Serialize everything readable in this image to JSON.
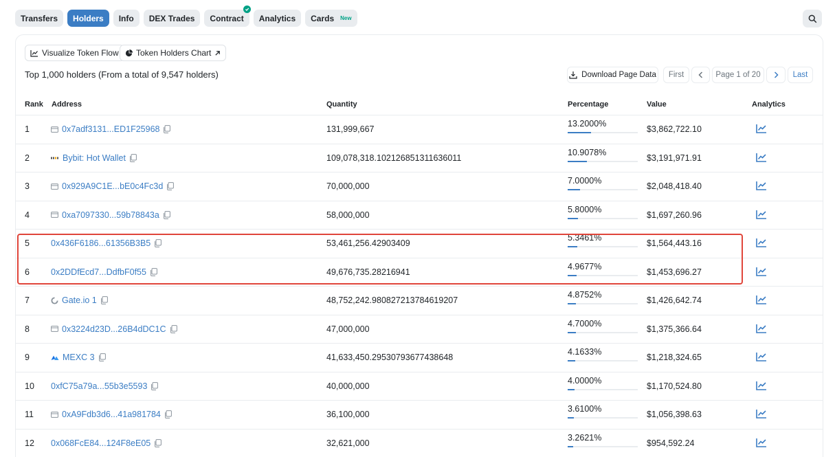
{
  "tabs": [
    {
      "label": "Transfers",
      "active": false
    },
    {
      "label": "Holders",
      "active": true
    },
    {
      "label": "Info",
      "active": false
    },
    {
      "label": "DEX Trades",
      "active": false
    },
    {
      "label": "Contract",
      "active": false,
      "verified": true
    },
    {
      "label": "Analytics",
      "active": false
    },
    {
      "label": "Cards",
      "active": false,
      "badge": "New"
    }
  ],
  "toolbar": {
    "visualize_label": "Visualize Token Flow",
    "chart_label": "Token Holders Chart"
  },
  "summary": "Top 1,000 holders (From a total of 9,547 holders)",
  "pager": {
    "download_label": "Download Page Data",
    "first": "First",
    "page_label": "Page 1 of 20",
    "last": "Last"
  },
  "table": {
    "headers": {
      "rank": "Rank",
      "address": "Address",
      "quantity": "Quantity",
      "percentage": "Percentage",
      "value": "Value",
      "analytics": "Analytics"
    },
    "rows": [
      {
        "rank": "1",
        "address": "0x7adf3131...ED1F25968",
        "icon": "contract-icon",
        "quantity": "131,999,667",
        "percentage": "13.2000%",
        "pct": 13.2,
        "value": "$3,862,722.10"
      },
      {
        "rank": "2",
        "address": "Bybit: Hot Wallet",
        "icon": "bybit-logo",
        "quantity": "109,078,318.102126851311636011",
        "percentage": "10.9078%",
        "pct": 10.9078,
        "value": "$3,191,971.91"
      },
      {
        "rank": "3",
        "address": "0x929A9C1E...bE0c4Fc3d",
        "icon": "contract-icon",
        "quantity": "70,000,000",
        "percentage": "7.0000%",
        "pct": 7.0,
        "value": "$2,048,418.40"
      },
      {
        "rank": "4",
        "address": "0xa7097330...59b78843a",
        "icon": "contract-icon",
        "quantity": "58,000,000",
        "percentage": "5.8000%",
        "pct": 5.8,
        "value": "$1,697,260.96"
      },
      {
        "rank": "5",
        "address": "0x436F6186...61356B3B5",
        "icon": "",
        "quantity": "53,461,256.42903409",
        "percentage": "5.3461%",
        "pct": 5.3461,
        "value": "$1,564,443.16"
      },
      {
        "rank": "6",
        "address": "0x2DDfEcd7...DdfbF0f55",
        "icon": "",
        "quantity": "49,676,735.28216941",
        "percentage": "4.9677%",
        "pct": 4.9677,
        "value": "$1,453,696.27"
      },
      {
        "rank": "7",
        "address": "Gate.io 1",
        "icon": "gateio-logo",
        "quantity": "48,752,242.980827213784619207",
        "percentage": "4.8752%",
        "pct": 4.8752,
        "value": "$1,426,642.74"
      },
      {
        "rank": "8",
        "address": "0x3224d23D...26B4dDC1C",
        "icon": "contract-icon",
        "quantity": "47,000,000",
        "percentage": "4.7000%",
        "pct": 4.7,
        "value": "$1,375,366.64"
      },
      {
        "rank": "9",
        "address": "MEXC 3",
        "icon": "mexc-logo",
        "quantity": "41,633,450.29530793677438648",
        "percentage": "4.1633%",
        "pct": 4.1633,
        "value": "$1,218,324.65"
      },
      {
        "rank": "10",
        "address": "0xfC75a79a...55b3e5593",
        "icon": "",
        "quantity": "40,000,000",
        "percentage": "4.0000%",
        "pct": 4.0,
        "value": "$1,170,524.80"
      },
      {
        "rank": "11",
        "address": "0xA9Fdb3d6...41a981784",
        "icon": "contract-icon",
        "quantity": "36,100,000",
        "percentage": "3.6100%",
        "pct": 3.61,
        "value": "$1,056,398.63"
      },
      {
        "rank": "12",
        "address": "0x068FcE84...124F8eE05",
        "icon": "",
        "quantity": "32,621,000",
        "percentage": "3.2621%",
        "pct": 3.2621,
        "value": "$954,592.24"
      }
    ]
  },
  "colors": {
    "accent": "#3b7dc4",
    "highlight": "#e0453a",
    "verified": "#00a186"
  }
}
